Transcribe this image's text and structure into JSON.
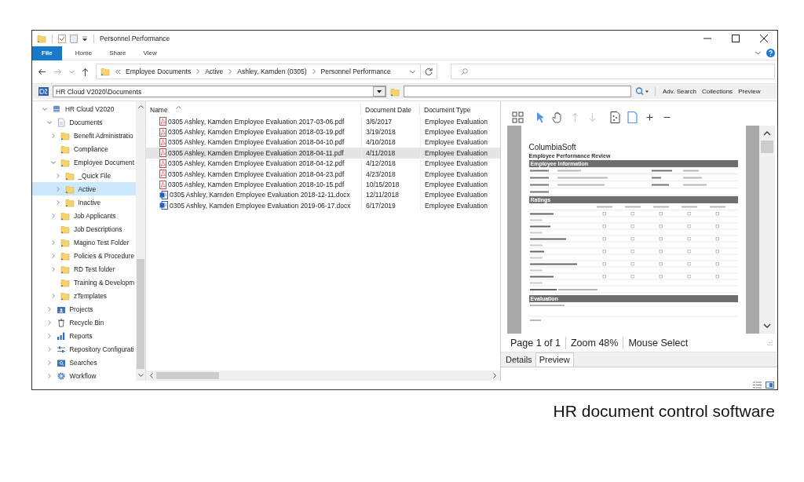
{
  "window": {
    "title": "Personnel Performance"
  },
  "ribbon": {
    "tabs": [
      {
        "label": "File",
        "kind": "file",
        "selected": false
      },
      {
        "label": "Home",
        "kind": "tab",
        "selected": false
      },
      {
        "label": "Share",
        "kind": "tab",
        "selected": false
      },
      {
        "label": "View",
        "kind": "tab",
        "selected": false
      }
    ]
  },
  "address_bar": {
    "breadcrumb": [
      "Employee Documents",
      "Active",
      "Ashley, Kamden (0305)",
      "Personnel Performance"
    ]
  },
  "repository_bar": {
    "path": "HR Cloud V2020\\Documents",
    "links": [
      "Adv. Search",
      "Collections",
      "Preview"
    ]
  },
  "tree": [
    {
      "label": "HR Cloud V2020",
      "kind": "database",
      "expandable": true,
      "expanded": true,
      "selected": false,
      "children": [
        {
          "label": "Documents",
          "kind": "document",
          "expandable": true,
          "expanded": true,
          "selected": false,
          "children": [
            {
              "label": "Benefit Administratio",
              "kind": "folder",
              "expandable": true,
              "expanded": false,
              "selected": false
            },
            {
              "label": "Compliance",
              "kind": "folder",
              "expandable": false,
              "expanded": false,
              "selected": false
            },
            {
              "label": "Employee Document",
              "kind": "folder",
              "expandable": true,
              "expanded": true,
              "selected": false,
              "children": [
                {
                  "label": "_Quick File",
                  "kind": "folder",
                  "expandable": true,
                  "expanded": false,
                  "selected": false
                },
                {
                  "label": "Active",
                  "kind": "folder",
                  "expandable": true,
                  "expanded": false,
                  "selected": true
                },
                {
                  "label": "Inactive",
                  "kind": "folder",
                  "expandable": true,
                  "expanded": false,
                  "selected": false
                }
              ]
            },
            {
              "label": "Job Applicants",
              "kind": "folder",
              "expandable": true,
              "expanded": false,
              "selected": false
            },
            {
              "label": "Job Descriptions",
              "kind": "folder",
              "expandable": false,
              "expanded": false,
              "selected": false
            },
            {
              "label": "Magino Test Folder",
              "kind": "folder",
              "expandable": true,
              "expanded": false,
              "selected": false
            },
            {
              "label": "Policies & Procedure",
              "kind": "folder",
              "expandable": true,
              "expanded": false,
              "selected": false
            },
            {
              "label": "RD Test folder",
              "kind": "folder",
              "expandable": true,
              "expanded": false,
              "selected": false
            },
            {
              "label": "Training & Developm",
              "kind": "folder",
              "expandable": false,
              "expanded": false,
              "selected": false
            },
            {
              "label": "zTemplates",
              "kind": "folder",
              "expandable": true,
              "expanded": false,
              "selected": false
            }
          ]
        },
        {
          "label": "Projects",
          "kind": "projects",
          "expandable": true,
          "expanded": false,
          "selected": false
        },
        {
          "label": "Recycle Bin",
          "kind": "recycle",
          "expandable": true,
          "expanded": false,
          "selected": false
        },
        {
          "label": "Reports",
          "kind": "reports",
          "expandable": true,
          "expanded": false,
          "selected": false
        },
        {
          "label": "Repository Configurati",
          "kind": "config",
          "expandable": true,
          "expanded": false,
          "selected": false
        },
        {
          "label": "Searches",
          "kind": "searches",
          "expandable": true,
          "expanded": false,
          "selected": false
        },
        {
          "label": "Workflow",
          "kind": "workflow",
          "expandable": true,
          "expanded": false,
          "selected": false
        }
      ]
    }
  ],
  "file_list": {
    "columns": [
      "Name",
      "Document Date",
      "Document Type"
    ],
    "rows": [
      {
        "name": "0305 Ashley, Kamden Employee Evaluation 2017-03-06.pdf",
        "date": "3/6/2017",
        "type": "Employee Evaluation",
        "kind": "pdf",
        "selected": false
      },
      {
        "name": "0305 Ashley, Kamden Employee Evaluation 2018-03-19.pdf",
        "date": "3/19/2018",
        "type": "Employee Evaluation",
        "kind": "pdf",
        "selected": false
      },
      {
        "name": "0305 Ashley, Kamden Employee Evaluation 2018-04-10.pdf",
        "date": "4/10/2018",
        "type": "Employee Evaluation",
        "kind": "pdf",
        "selected": false
      },
      {
        "name": "0305 Ashley, Kamden Employee Evaluation 2018-04-11.pdf",
        "date": "4/11/2018",
        "type": "Employee Evaluation",
        "kind": "pdf",
        "selected": true
      },
      {
        "name": "0305 Ashley, Kamden Employee Evaluation 2018-04-12.pdf",
        "date": "4/12/2018",
        "type": "Employee Evaluation",
        "kind": "pdf",
        "selected": false
      },
      {
        "name": "0305 Ashley, Kamden Employee Evaluation 2018-04-23.pdf",
        "date": "4/23/2018",
        "type": "Employee Evaluation",
        "kind": "pdf",
        "selected": false
      },
      {
        "name": "0305 Ashley, Kamden Employee Evaluation 2018-10-15.pdf",
        "date": "10/15/2018",
        "type": "Employee Evaluation",
        "kind": "pdf",
        "selected": false
      },
      {
        "name": "0305 Ashley, Kamden Employee Evaluation 2018-12-11.docx",
        "date": "12/11/2018",
        "type": "Employee Evaluation",
        "kind": "docx",
        "selected": false
      },
      {
        "name": "0305 Ashley, Kamden Employee Evaluation 2019-06-17.docx",
        "date": "6/17/2019",
        "type": "Employee Evaluation",
        "kind": "docx",
        "selected": false
      }
    ]
  },
  "preview": {
    "tools": [
      {
        "kind": "thumbnails",
        "selected": false,
        "disabled": false
      },
      {
        "kind": "pointer",
        "selected": true,
        "disabled": false
      },
      {
        "kind": "hand",
        "selected": false,
        "disabled": false
      },
      {
        "kind": "prev",
        "selected": false,
        "disabled": true
      },
      {
        "kind": "next",
        "selected": false,
        "disabled": true
      },
      {
        "kind": "fit",
        "selected": false,
        "disabled": false
      },
      {
        "kind": "page",
        "selected": true,
        "disabled": false
      },
      {
        "kind": "zoom_in",
        "selected": false,
        "disabled": false
      },
      {
        "kind": "zoom_out",
        "selected": false,
        "disabled": false
      }
    ],
    "document": {
      "brand": "ColumbiaSoft",
      "title": "Employee Performance Review",
      "sections": [
        {
          "kind": "info",
          "heading": "Employee Information"
        },
        {
          "kind": "ratings",
          "heading": "Ratings"
        },
        {
          "kind": "evaluation",
          "heading": "Evaluation"
        }
      ]
    },
    "status": [
      "Page 1 of 1",
      "Zoom 48%",
      "Mouse Select"
    ],
    "tabs": [
      {
        "label": "Details",
        "selected": false
      },
      {
        "label": "Preview",
        "selected": true
      }
    ]
  },
  "caption": "HR document control software"
}
